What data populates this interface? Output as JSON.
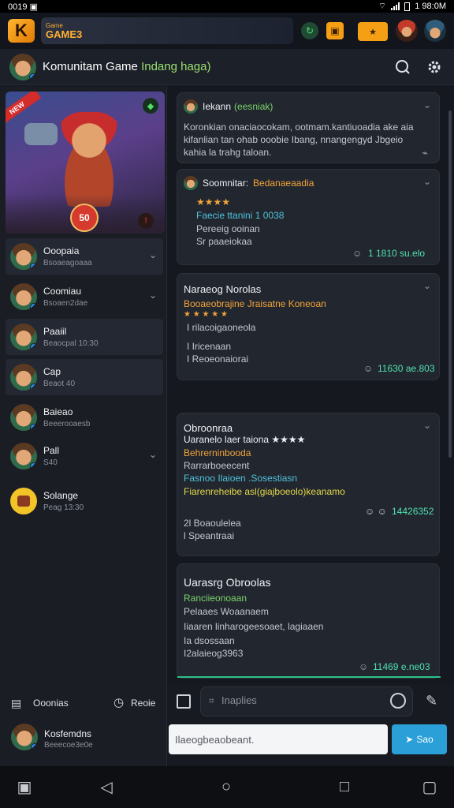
{
  "status_bar": {
    "left": "0019 ▣",
    "time": "1 98:0M"
  },
  "game_bar": {
    "brand_small": "Game",
    "brand_name": "GAME3",
    "orange_button": "★"
  },
  "header": {
    "title": "Komunitam Game",
    "subtitle": "Indang haga)"
  },
  "hero": {
    "ribbon": "NEW",
    "emblem": "50"
  },
  "sidebar": {
    "chats": [
      {
        "name": "Ooopaia",
        "meta": "Bsoaeagoaaa"
      },
      {
        "name": "Coomiau",
        "meta": "Bsoaen2dae"
      },
      {
        "name": "Paaiil",
        "meta": "Beaocpal 10:30"
      },
      {
        "name": "Cap",
        "meta": "Beaot 40"
      },
      {
        "name": "Baieao",
        "meta": "Beeerooaesb"
      },
      {
        "name": "Pall",
        "meta": "S40"
      },
      {
        "name": "Solange",
        "meta": "Peag 13:30"
      }
    ],
    "footer_left": "Ooonias",
    "footer_right": "Reoie",
    "profile_name": "Kosfemdns",
    "profile_meta": "Beeecoe3e0e"
  },
  "messages": [
    {
      "sender": "Iekann",
      "sender_tag": "(eesniak)",
      "lines": [
        "Koronkian onaciaocokam, ootmam.kantiuoadia ake aia",
        "kifanlian tan ohab ooobie Ibang, nnangengyd Jbgeio",
        "kahia la trahg taloan."
      ]
    },
    {
      "sender": "Soomnitar:",
      "sender_tag": "Bedanaeaadia",
      "stars": "★★★★",
      "lines": [
        "Faecie ttanini 1 0038",
        "Pereeig ooinan",
        "Sr paaeiokaa"
      ],
      "time": "1 1810 su.elo"
    },
    {
      "title": "Naraeog Norolas",
      "lines": [
        "Booaeobrajine Jraisatne Koneoan",
        "★ ★ ★ ★ ★",
        "I rilacoigaoneola",
        "I Iricenaan",
        "I Reoeonaiorai"
      ],
      "time": "11630 ae.803"
    },
    {
      "title": "Obroonraa",
      "lines": [
        "Uaranelo laer taiona ★★★★",
        "Behrerninbooda",
        "Rarrarboeecent",
        "Fasnoo Ilaioen .Sosestiasn",
        "Fiarenreheibe asl(giajboeolo)keanamo",
        "2l Boaoulelea",
        "l Speantraai"
      ],
      "time": "14426352"
    },
    {
      "title": "Uarasrg Obroolas",
      "lines": [
        "Ranciieonoaan",
        "Pelaaes Woaanaem",
        "Iiaaren linharogeesoaet, lagiaaen",
        "Ia dsossaan",
        "I2alaieog3963"
      ],
      "time": "11469 e.ne03"
    }
  ],
  "composer": {
    "search_placeholder": "Inaplies",
    "input_value": "Ilaeogbeaobeant.",
    "send_label": "Sao"
  }
}
